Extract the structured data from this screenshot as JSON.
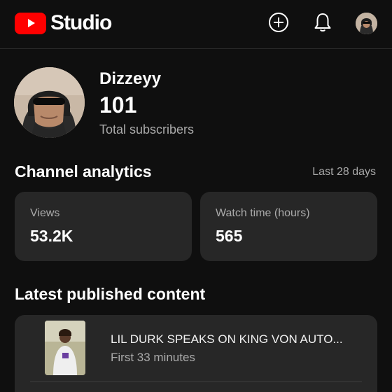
{
  "header": {
    "app_name": "Studio",
    "icons": [
      "youtube-logo-icon",
      "create-icon",
      "bell-icon",
      "account-avatar"
    ]
  },
  "channel": {
    "name": "Dizzeyy",
    "subscriber_count": "101",
    "subscriber_label": "Total subscribers"
  },
  "analytics": {
    "title": "Channel analytics",
    "period": "Last 28 days",
    "cards": [
      {
        "label": "Views",
        "value": "53.2K"
      },
      {
        "label": "Watch time (hours)",
        "value": "565"
      }
    ]
  },
  "latest": {
    "title": "Latest published content",
    "video": {
      "title": "LIL DURK SPEAKS ON KING VON AUTO...",
      "meta": "First 33 minutes"
    }
  },
  "colors": {
    "background": "#0f0f0f",
    "card": "#272727",
    "brand_red": "#ff0000",
    "secondary_text": "#aaaaaa"
  }
}
